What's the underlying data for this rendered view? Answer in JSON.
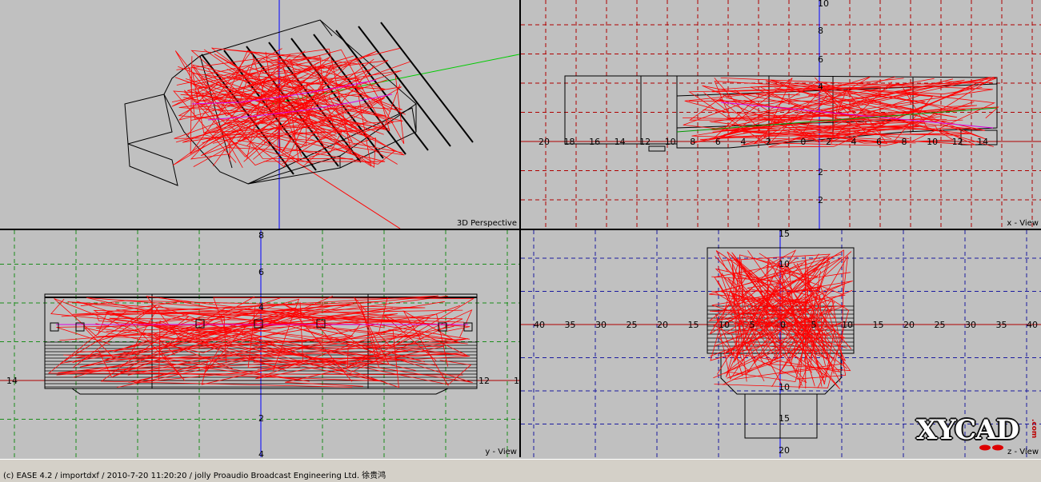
{
  "viewports": {
    "perspective": {
      "label": "3D Perspective"
    },
    "xview": {
      "label": "x - View",
      "xticks": [
        "20",
        "18",
        "16",
        "14",
        "12",
        "10",
        "8",
        "6",
        "4",
        "2",
        "0",
        "2",
        "4",
        "6",
        "8",
        "10",
        "12",
        "14"
      ],
      "yticks": [
        "10",
        "8",
        "6",
        "4",
        "2",
        "2",
        "4"
      ]
    },
    "yview": {
      "label": "y - View",
      "xticks": [
        "14",
        "12",
        "1"
      ],
      "yticks": [
        "8",
        "6",
        "4",
        "2",
        "4"
      ]
    },
    "zview": {
      "label": "z - View",
      "xticks": [
        "40",
        "35",
        "30",
        "25",
        "20",
        "15",
        "10",
        "5",
        "0",
        "5",
        "10",
        "15",
        "20",
        "25",
        "30",
        "35",
        "40"
      ],
      "yticks": [
        "15",
        "10",
        "10",
        "15",
        "20"
      ]
    }
  },
  "colors": {
    "grid_red": "#b00000",
    "grid_green": "#1a8c1a",
    "grid_blue": "#1a1aa0",
    "model_black": "#000000",
    "model_red": "#ff0000",
    "model_magenta": "#e000e0",
    "model_green": "#009900"
  },
  "status": {
    "text": "(c) EASE 4.2  / importdxf  / 2010-7-20 11:20:20 / jolly Proaudio Broadcast Engineering Ltd. 徐贵鸿"
  },
  "logo": {
    "text": "XYCAD",
    "suffix": ".com"
  }
}
